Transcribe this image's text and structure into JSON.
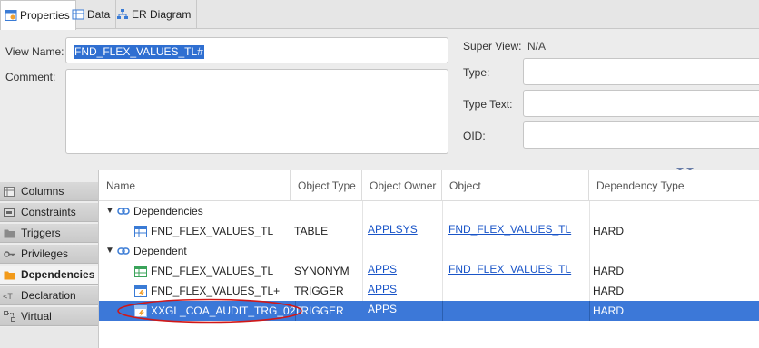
{
  "tabs": [
    {
      "label": "Properties",
      "icon": "properties-icon",
      "active": true
    },
    {
      "label": "Data",
      "icon": "data-grid-icon",
      "active": false
    },
    {
      "label": "ER Diagram",
      "icon": "er-diagram-icon",
      "active": false
    }
  ],
  "form": {
    "view_name_label": "View Name:",
    "view_name_value": "FND_FLEX_VALUES_TL#",
    "comment_label": "Comment:",
    "super_view_label": "Super View:",
    "super_view_value": "N/A",
    "type_label": "Type:",
    "type_text_label": "Type Text:",
    "oid_label": "OID:"
  },
  "side_tabs": [
    {
      "label": "Columns",
      "icon": "columns-icon"
    },
    {
      "label": "Constraints",
      "icon": "constraints-icon"
    },
    {
      "label": "Triggers",
      "icon": "triggers-folder-icon"
    },
    {
      "label": "Privileges",
      "icon": "key-icon"
    },
    {
      "label": "Dependencies",
      "icon": "dependencies-folder-icon",
      "active": true
    },
    {
      "label": "Declaration",
      "icon": "declaration-icon"
    },
    {
      "label": "Virtual",
      "icon": "virtual-icon"
    }
  ],
  "table": {
    "headers": [
      "Name",
      "Object Type",
      "Object Owner",
      "Object",
      "Dependency Type"
    ],
    "rows": [
      {
        "kind": "group",
        "name": "Dependencies"
      },
      {
        "kind": "item",
        "name": "FND_FLEX_VALUES_TL",
        "icon": "table-icon",
        "type": "TABLE",
        "owner": "APPLSYS",
        "object": "FND_FLEX_VALUES_TL",
        "dep": "HARD"
      },
      {
        "kind": "group",
        "name": "Dependent"
      },
      {
        "kind": "item",
        "name": "FND_FLEX_VALUES_TL",
        "icon": "synonym-icon",
        "type": "SYNONYM",
        "owner": "APPS",
        "object": "FND_FLEX_VALUES_TL",
        "dep": "HARD"
      },
      {
        "kind": "item",
        "name": "FND_FLEX_VALUES_TL+",
        "icon": "trigger-icon",
        "type": "TRIGGER",
        "owner": "APPS",
        "object": "",
        "dep": "HARD"
      },
      {
        "kind": "item",
        "name": "XXGL_COA_AUDIT_TRG_02",
        "icon": "trigger-icon",
        "type": "TRIGGER",
        "owner": "APPS",
        "object": "",
        "dep": "HARD",
        "selected": true
      }
    ]
  },
  "colors": {
    "selection": "#3c78d8",
    "link": "#1a55c8",
    "annotation": "#d01818"
  }
}
